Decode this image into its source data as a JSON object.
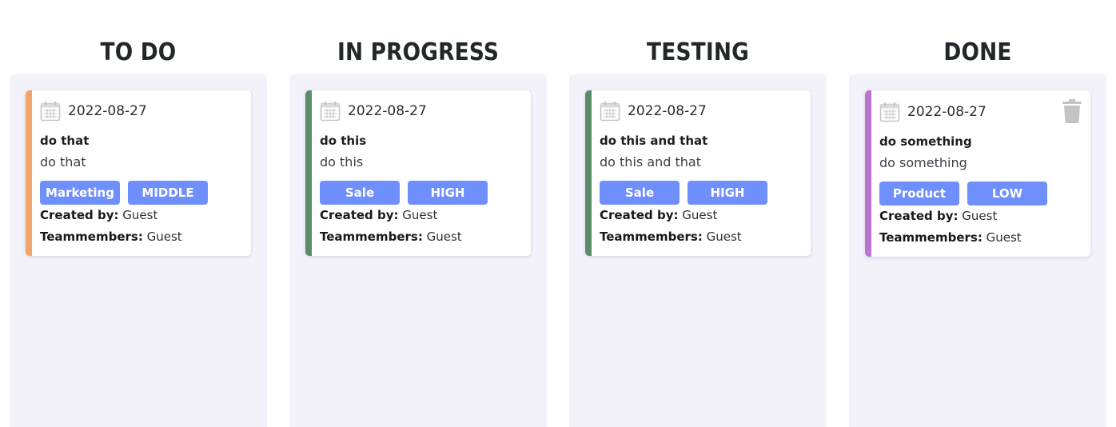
{
  "colors": {
    "column_background": "#f3f2fb",
    "tag_background": "#6f8ffd",
    "stripe_orange": "#f1a56c",
    "stripe_green": "#5b8c6a",
    "stripe_purple": "#bb74d3",
    "icon_gray": "#c4c4c4"
  },
  "columns": [
    {
      "title": "TO DO",
      "cards": [
        {
          "date": "2022-08-27",
          "title": "do that",
          "description": "do that",
          "tags": [
            "Marketing",
            "MIDDLE"
          ],
          "created_by_label": "Created by:",
          "created_by": " Guest",
          "teammembers_label": "Teammembers:",
          "teammembers": " Guest",
          "stripe_color": "#f1a56c",
          "icon": "calendar-icon"
        }
      ]
    },
    {
      "title": "IN PROGRESS",
      "cards": [
        {
          "date": "2022-08-27",
          "title": "do this",
          "description": "do this",
          "tags": [
            "Sale",
            "HIGH"
          ],
          "created_by_label": "Created by:",
          "created_by": " Guest",
          "teammembers_label": "Teammembers:",
          "teammembers": " Guest",
          "stripe_color": "#5b8c6a",
          "icon": "calendar-icon"
        }
      ]
    },
    {
      "title": "TESTING",
      "cards": [
        {
          "date": "2022-08-27",
          "title": "do this and that",
          "description": "do this and that",
          "tags": [
            "Sale",
            "HIGH"
          ],
          "created_by_label": "Created by:",
          "created_by": " Guest",
          "teammembers_label": "Teammembers:",
          "teammembers": " Guest",
          "stripe_color": "#5b8c6a",
          "icon": "calendar-icon"
        }
      ]
    },
    {
      "title": "DONE",
      "cards": [
        {
          "date": "2022-08-27",
          "title": "do something",
          "description": "do something",
          "tags": [
            "Product",
            "LOW"
          ],
          "created_by_label": "Created by:",
          "created_by": " Guest",
          "teammembers_label": "Teammembers:",
          "teammembers": " Guest",
          "stripe_color": "#bb74d3",
          "icon": "calendar-icon",
          "delete_icon": "trash-icon"
        }
      ]
    }
  ]
}
